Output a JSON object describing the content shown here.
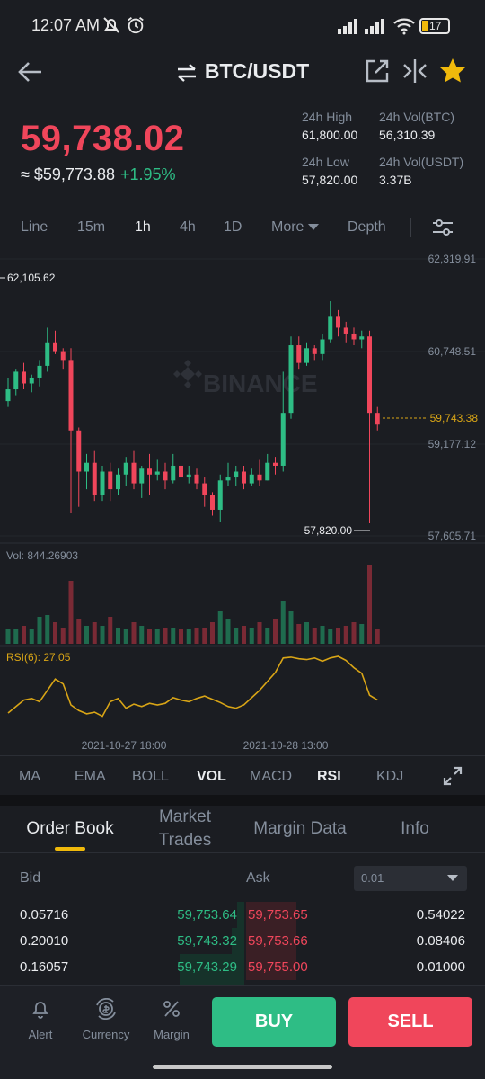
{
  "status": {
    "time": "12:07 AM",
    "battery": "17"
  },
  "header": {
    "pair": "BTC/USDT"
  },
  "price": {
    "last": "59,738.02",
    "approx": "≈ $59,773.88",
    "change": "+1.95%",
    "stats": {
      "high_label": "24h High",
      "high": "61,800.00",
      "vol_btc_label": "24h Vol(BTC)",
      "vol_btc": "56,310.39",
      "low_label": "24h Low",
      "low": "57,820.00",
      "vol_usdt_label": "24h Vol(USDT)",
      "vol_usdt": "3.37B"
    }
  },
  "timeframes": [
    "Line",
    "15m",
    "1h",
    "4h",
    "1D",
    "More",
    "Depth"
  ],
  "chart": {
    "axis": [
      "62,319.91",
      "60,748.51",
      "59,177.12",
      "57,605.71"
    ],
    "marker_high": "62,105.62",
    "marker_low": "57,820.00",
    "current": "59,743.38",
    "watermark": "BINANCE",
    "vol_label": "Vol: 844.26903",
    "rsi_label": "RSI(6): 27.05",
    "date1": "2021-10-27 18:00",
    "date2": "2021-10-28 13:00"
  },
  "chart_data": {
    "type": "candlestick",
    "price_axis": [
      62319.91,
      60748.51,
      59177.12,
      57605.71
    ],
    "candles": [
      [
        59900,
        60100,
        60300,
        59800
      ],
      [
        60100,
        60400,
        60450,
        60000
      ],
      [
        60400,
        60200,
        60550,
        60100
      ],
      [
        60200,
        60300,
        60350,
        60050
      ],
      [
        60300,
        60500,
        60600,
        60150
      ],
      [
        60500,
        60900,
        61150,
        60400
      ],
      [
        60900,
        60750,
        61100,
        60700
      ],
      [
        60750,
        60600,
        60800,
        60450
      ],
      [
        60600,
        59400,
        60800,
        58000
      ],
      [
        59400,
        58700,
        59450,
        58100
      ],
      [
        58700,
        58850,
        59000,
        58400
      ],
      [
        58850,
        58300,
        59050,
        58200
      ],
      [
        58300,
        58700,
        58800,
        58200
      ],
      [
        58700,
        58400,
        58850,
        58200
      ],
      [
        58400,
        58650,
        58750,
        58300
      ],
      [
        58650,
        58850,
        58950,
        58450
      ],
      [
        58850,
        58500,
        59050,
        58400
      ],
      [
        58500,
        58750,
        58800,
        58250
      ],
      [
        58750,
        58650,
        59000,
        58300
      ],
      [
        58650,
        58700,
        58900,
        58550
      ],
      [
        58700,
        58550,
        58850,
        58400
      ],
      [
        58550,
        58800,
        59000,
        58500
      ],
      [
        58800,
        58600,
        58900,
        58450
      ],
      [
        58600,
        58650,
        58800,
        58500
      ],
      [
        58650,
        58500,
        58750,
        58400
      ],
      [
        58500,
        58300,
        58600,
        58100
      ],
      [
        58300,
        58050,
        58350,
        57950
      ],
      [
        58050,
        58550,
        58650,
        57850
      ],
      [
        58550,
        58600,
        58850,
        58450
      ],
      [
        58600,
        58700,
        58800,
        58450
      ],
      [
        58700,
        58500,
        58800,
        58400
      ],
      [
        58500,
        58650,
        58750,
        58450
      ],
      [
        58650,
        58550,
        58900,
        58450
      ],
      [
        58550,
        58850,
        59000,
        58550
      ],
      [
        58850,
        58800,
        58950,
        58650
      ],
      [
        58800,
        59700,
        60400,
        58700
      ],
      [
        59700,
        60850,
        61000,
        59600
      ],
      [
        60850,
        60550,
        61000,
        60450
      ],
      [
        60550,
        60800,
        60900,
        60500
      ],
      [
        60800,
        60700,
        60850,
        60600
      ],
      [
        60700,
        60950,
        61050,
        60600
      ],
      [
        60950,
        61350,
        61600,
        60900
      ],
      [
        61350,
        61150,
        61450,
        61000
      ],
      [
        61150,
        61050,
        61250,
        60900
      ],
      [
        61050,
        60950,
        61150,
        60850
      ],
      [
        60950,
        61000,
        61100,
        60800
      ],
      [
        61000,
        59700,
        61100,
        57820
      ],
      [
        59700,
        59500,
        59800,
        59400
      ]
    ],
    "volume": [
      8,
      8,
      10,
      8,
      15,
      16,
      12,
      9,
      35,
      14,
      10,
      12,
      10,
      15,
      9,
      8,
      12,
      10,
      8,
      8,
      9,
      9,
      8,
      8,
      9,
      9,
      12,
      18,
      14,
      9,
      10,
      9,
      12,
      9,
      14,
      24,
      18,
      11,
      12,
      9,
      10,
      8,
      9,
      10,
      12,
      11,
      44,
      8
    ],
    "rsi": [
      30,
      38,
      46,
      48,
      44,
      58,
      72,
      66,
      40,
      33,
      29,
      31,
      26,
      44,
      48,
      36,
      41,
      38,
      42,
      40,
      42,
      49,
      46,
      44,
      48,
      51,
      47,
      43,
      38,
      36,
      40,
      49,
      58,
      69,
      80,
      98,
      99,
      97,
      96,
      98,
      94,
      98,
      100,
      95,
      86,
      79,
      52,
      46
    ]
  },
  "indicators": [
    "MA",
    "EMA",
    "BOLL",
    "VOL",
    "MACD",
    "RSI",
    "KDJ"
  ],
  "orderbook": {
    "tabs": [
      "Order Book",
      "Market Trades",
      "Margin Data",
      "Info"
    ],
    "bid_label": "Bid",
    "ask_label": "Ask",
    "precision": "0.01",
    "rows": [
      {
        "bid": "0.05716",
        "bid_price": "59,753.64",
        "ask_price": "59,753.65",
        "ask": "0.54022"
      },
      {
        "bid": "0.20010",
        "bid_price": "59,743.32",
        "ask_price": "59,753.66",
        "ask": "0.08406"
      },
      {
        "bid": "0.16057",
        "bid_price": "59,743.29",
        "ask_price": "59,755.00",
        "ask": "0.01000"
      }
    ]
  },
  "bottom": {
    "alert": "Alert",
    "currency": "Currency",
    "margin": "Margin",
    "buy": "BUY",
    "sell": "SELL"
  },
  "colors": {
    "up": "#2ebd85",
    "down": "#f0465b",
    "accent": "#f0b90b",
    "bg": "#1b1d22"
  }
}
